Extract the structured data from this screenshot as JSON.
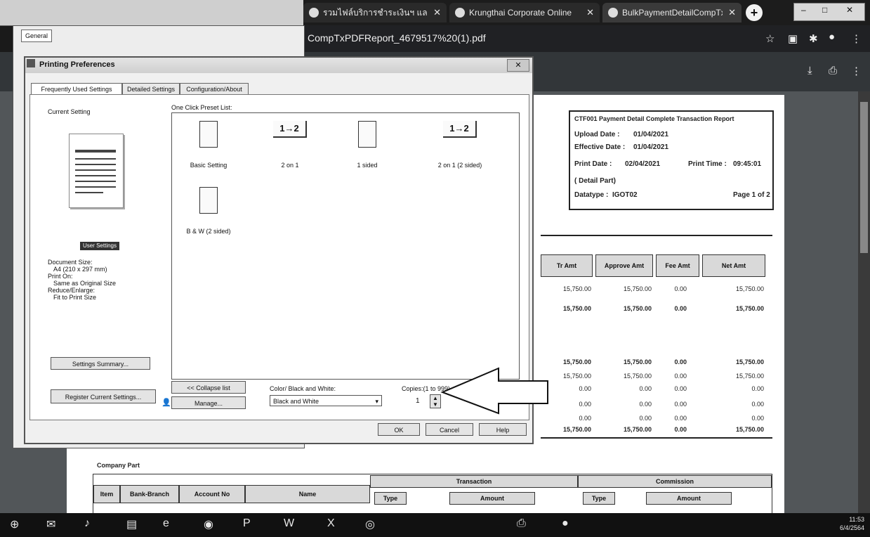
{
  "browser": {
    "tabs": [
      {
        "label": "รวมไฟล์บริการชำระเงินฯ และ"
      },
      {
        "label": "Krungthai Corporate Online"
      },
      {
        "label": "BulkPaymentDetailCompTxPDF"
      }
    ],
    "url": "CompTxPDFReport_4679517%20(1).pdf"
  },
  "left_window": {
    "general_tab": "General"
  },
  "dialog": {
    "title": "Printing Preferences",
    "tabs": [
      "Frequently Used Settings",
      "Detailed Settings",
      "Configuration/About"
    ],
    "current_setting_label": "Current Setting",
    "user_settings_button": "User Settings",
    "document_info": {
      "doc_size_label": "Document Size:",
      "doc_size_value": "A4 (210 x 297 mm)",
      "print_on_label": "Print On:",
      "print_on_value": "Same as Original Size",
      "reduce_label": "Reduce/Enlarge:",
      "reduce_value": "Fit to Print Size"
    },
    "settings_summary_button": "Settings Summary...",
    "register_button": "Register Current Settings...",
    "preset_list_label": "One Click Preset List:",
    "presets": [
      {
        "label": "Basic Setting",
        "icon_text": ""
      },
      {
        "label": "2 on 1",
        "icon_text": "1→2"
      },
      {
        "label": "1 sided",
        "icon_text": ""
      },
      {
        "label": "2 on 1 (2 sided)",
        "icon_text": "1→2"
      },
      {
        "label": "B & W (2 sided)",
        "icon_text": ""
      }
    ],
    "collapse_button": "<< Collapse list",
    "manage_button": "Manage...",
    "color_label": "Color/ Black and White:",
    "color_value": "Black and White",
    "copies_label": "Copies:(1 to 999)",
    "copies_value": "1",
    "ok_button": "OK",
    "cancel_button": "Cancel",
    "help_button": "Help"
  },
  "report": {
    "title": "CTF001 Payment Detail Complete Transaction Report",
    "upload_date_label": "Upload Date :",
    "upload_date": "01/04/2021",
    "effective_date_label": "Effective Date :",
    "effective_date": "01/04/2021",
    "print_date_label": "Print Date :",
    "print_date": "02/04/2021",
    "print_time_label": "Print Time :",
    "print_time": "09:45:01",
    "detail_part": "( Detail Part)",
    "datatype_label": "Datatype :",
    "datatype": "IGOT02",
    "page_info": "Page 1 of 2",
    "columns": [
      "Tr Amt",
      "Approve Amt",
      "Fee Amt",
      "Net Amt"
    ],
    "rows": [
      [
        "15,750.00",
        "15,750.00",
        "0.00",
        "15,750.00"
      ],
      [
        "15,750.00",
        "15,750.00",
        "0.00",
        "15,750.00"
      ],
      [
        "15,750.00",
        "15,750.00",
        "0.00",
        "15,750.00"
      ],
      [
        "15,750.00",
        "15,750.00",
        "0.00",
        "15,750.00"
      ],
      [
        "0.00",
        "0.00",
        "0.00",
        "0.00"
      ],
      [
        "0.00",
        "0.00",
        "0.00",
        "0.00"
      ],
      [
        "0.00",
        "0.00",
        "0.00",
        "0.00"
      ],
      [
        "15,750.00",
        "15,750.00",
        "0.00",
        "15,750.00"
      ]
    ],
    "company_part": "Company Part",
    "bottom_headers": [
      "Item",
      "Bank-Branch",
      "Account No",
      "Name",
      "Transaction",
      "Commission"
    ],
    "bottom_subheaders": [
      "Type",
      "Amount",
      "Type",
      "Amount"
    ]
  },
  "taskbar": {
    "clock_time": "11:53",
    "clock_date": "6/4/2564"
  }
}
